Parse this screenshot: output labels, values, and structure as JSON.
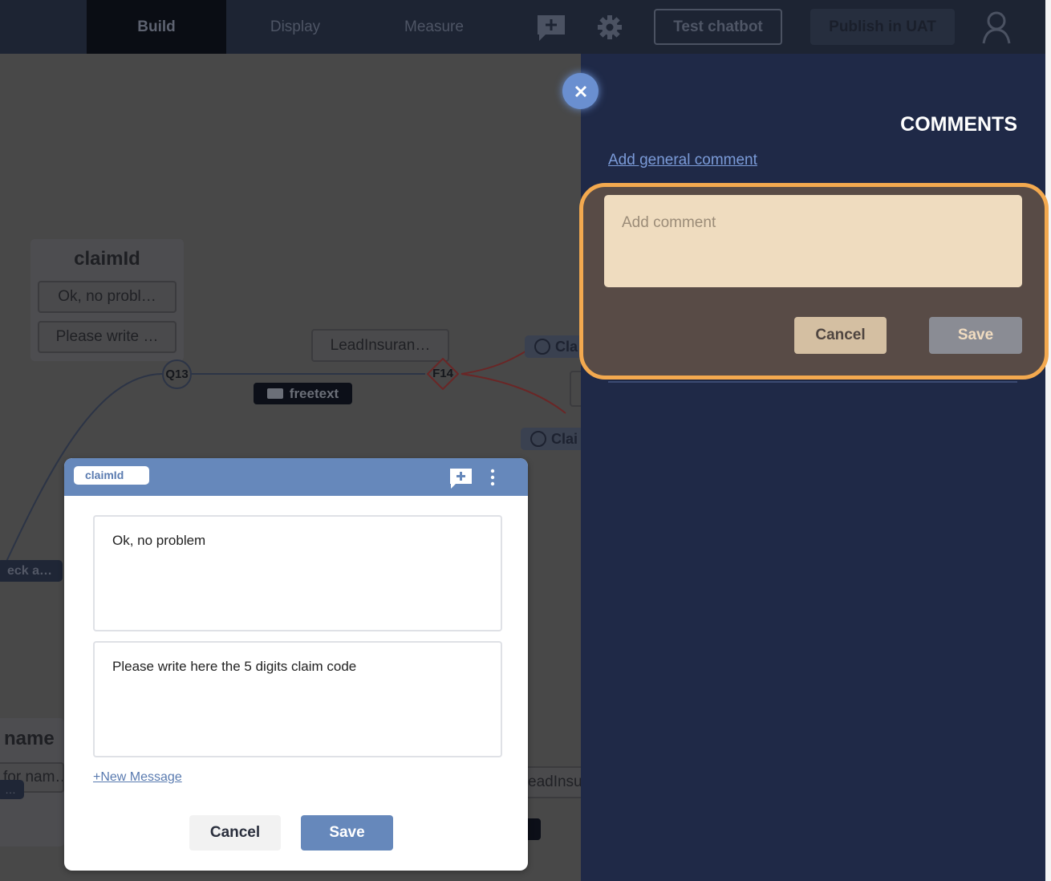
{
  "topbar": {
    "tabs": [
      {
        "label": "Build",
        "active": true
      },
      {
        "label": "Display"
      },
      {
        "label": "Measure"
      }
    ],
    "icons": [
      "add-comment-icon",
      "gear-icon",
      "user-icon"
    ],
    "test_chatbot": "Test chatbot",
    "publish": "Publish in UAT"
  },
  "canvas": {
    "claim_node": {
      "title": "claimId",
      "items": [
        "Ok, no probl…",
        "Please write …"
      ]
    },
    "lead_box": "LeadInsuran…",
    "q_node": "Q13",
    "f_node": "F14",
    "freetext_badge": "freetext",
    "gear_node_1": "Cla",
    "gear_node_2": "Clai",
    "left_badge": "eck a…",
    "name_node": {
      "title": "name",
      "item": "for nam…",
      "badge": "…"
    },
    "lead_box_2": "eadInsu"
  },
  "modal": {
    "tag": "claimId",
    "messages": [
      "Ok, no problem",
      "Please write here the 5 digits claim code"
    ],
    "new_message": "+New Message",
    "cancel": "Cancel",
    "save": "Save"
  },
  "comments": {
    "title": "COMMENTS",
    "add_general": "Add general comment",
    "placeholder": "Add comment",
    "cancel": "Cancel",
    "save": "Save",
    "highlight_color": "#f3a94f"
  }
}
